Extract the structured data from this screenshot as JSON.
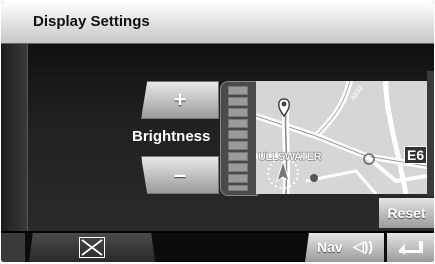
{
  "header": {
    "title": "Display Settings"
  },
  "brightness": {
    "label": "Brightness",
    "plus": "+",
    "minus": "–",
    "level_fraction": 0.0
  },
  "map": {
    "road_label": "ULLSWATER",
    "route_badge": "E6"
  },
  "buttons": {
    "reset": "Reset"
  },
  "bottom_bar": {
    "nav_label": "Nav",
    "nav_icon": "speaker-icon",
    "back_icon": "back-arrow-icon",
    "close_icon": "close-icon"
  },
  "colors": {
    "button_top": "#e8e8e8",
    "button_bottom": "#9b9b9b",
    "background": "#1a1a1a"
  }
}
